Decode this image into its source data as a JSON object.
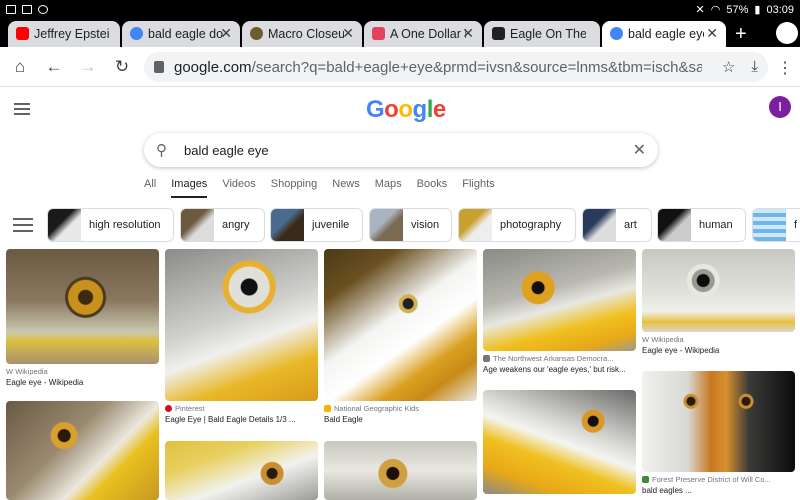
{
  "status_bar": {
    "battery": "57%",
    "time": "03:09"
  },
  "tabs": [
    {
      "label": "Jeffrey Epstein",
      "color": "#ff0000"
    },
    {
      "label": "bald eagle doll",
      "color": "#4285f4"
    },
    {
      "label": "Macro Closeup",
      "color": "#6d5c2e"
    },
    {
      "label": "A One Dollar Bill",
      "color": "#e4405f"
    },
    {
      "label": "Eagle On The",
      "color": "#202124"
    },
    {
      "label": "bald eagle eye",
      "color": "#4285f4"
    }
  ],
  "url": {
    "domain": "google.com",
    "rest": "/search?q=bald+eagle+eye&prmd=ivsn&source=lnms&tbm=isch&sa=X&ve"
  },
  "avatar_letter": "I",
  "search": {
    "query": "bald eagle eye"
  },
  "nav_tabs": [
    "All",
    "Images",
    "Videos",
    "Shopping",
    "News",
    "Maps",
    "Books",
    "Flights"
  ],
  "chips": [
    "high resolution",
    "angry",
    "juvenile",
    "vision",
    "photography",
    "art",
    "human",
    "f"
  ],
  "results": [
    {
      "source": "Wikipedia",
      "title": "Eagle eye - Wikipedia",
      "source_color": "#888888"
    },
    {
      "source": "Pinterest",
      "title": "Eagle Eye | Bald Eagle Details 1/3 ...",
      "source_color": "#e60023"
    },
    {
      "source": "National Geographic Kids",
      "title": "Bald Eagle",
      "source_color": "#f4b400"
    },
    {
      "source": "The Northwest Arkansas Democra...",
      "title": "Age weakens our 'eagle eyes,' but risk...",
      "source_color": "#777777"
    },
    {
      "source": "Wikipedia",
      "title": "Eagle eye - Wikipedia",
      "source_color": "#888888"
    },
    {
      "source": "Forest Preserve District of Will Co...",
      "title": "bald eagles ...",
      "source_color": "#3a8a3a"
    }
  ]
}
